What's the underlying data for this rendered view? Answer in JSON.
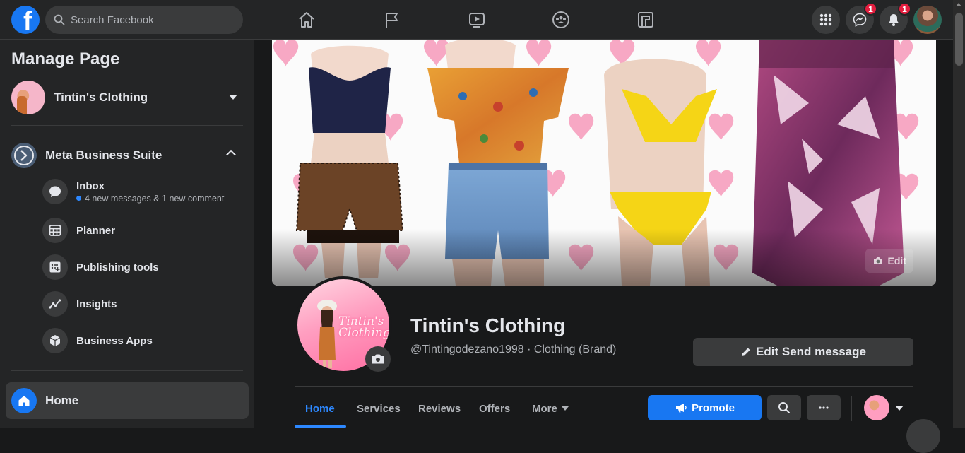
{
  "topbar": {
    "search_placeholder": "Search Facebook",
    "nav_icons": [
      "home-icon",
      "flag-icon",
      "watch-icon",
      "groups-icon",
      "gaming-icon"
    ],
    "messenger_badge": "1",
    "notifications_badge": "1"
  },
  "sidebar": {
    "title": "Manage Page",
    "page_name": "Tintin's Clothing",
    "section_label": "Meta Business Suite",
    "items": [
      {
        "label": "Inbox",
        "sub": "4 new messages & 1 new comment",
        "icon": "chat-bubble-icon"
      },
      {
        "label": "Planner",
        "icon": "calendar-grid-icon"
      },
      {
        "label": "Publishing tools",
        "icon": "publishing-tools-icon"
      },
      {
        "label": "Insights",
        "icon": "insights-chart-icon"
      },
      {
        "label": "Business Apps",
        "icon": "cube-icon"
      }
    ],
    "home_label": "Home"
  },
  "cover": {
    "edit_label": "Edit"
  },
  "profile": {
    "logo_text_line1": "Tintin's",
    "logo_text_line2": "Clothing",
    "name": "Tintin's Clothing",
    "handle": "@Tintingodezano1998 · Clothing (Brand)",
    "edit_send_label": "Edit Send message"
  },
  "tabs": {
    "items": [
      "Home",
      "Services",
      "Reviews",
      "Offers",
      "More"
    ],
    "active": "Home",
    "promote_label": "Promote"
  },
  "colors": {
    "accent": "#1877f2",
    "link_blue": "#2d88ff",
    "badge_red": "#e41e3f",
    "background": "#18191a",
    "surface": "#242526",
    "surface_alt": "#3a3b3c"
  }
}
